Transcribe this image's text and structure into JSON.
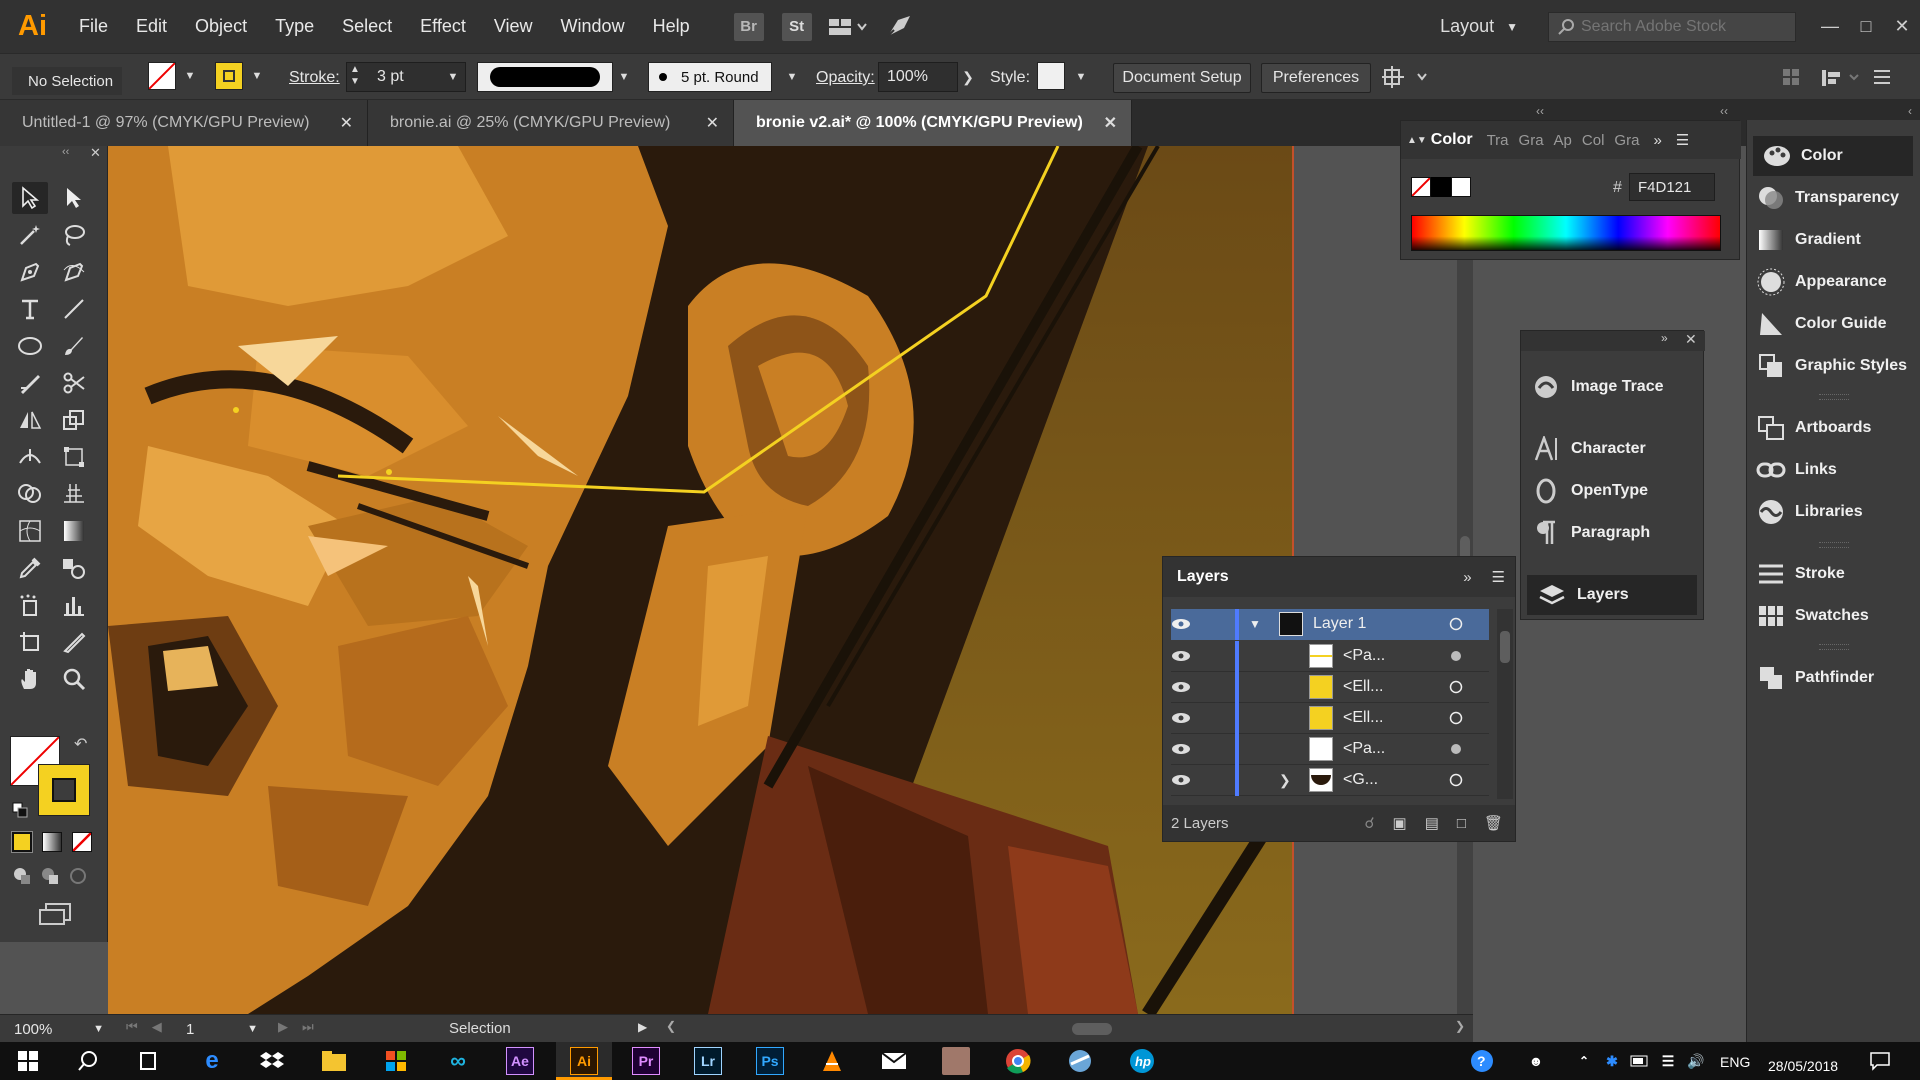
{
  "app": {
    "logo": "Ai"
  },
  "menu": [
    "File",
    "Edit",
    "Object",
    "Type",
    "Select",
    "Effect",
    "View",
    "Window",
    "Help"
  ],
  "bridge": {
    "br": "Br",
    "st": "St"
  },
  "workspace": "Layout",
  "stock_search": {
    "placeholder": "Search Adobe Stock"
  },
  "control": {
    "selection": "No Selection",
    "stroke_label": "Stroke:",
    "stroke_weight": "3 pt",
    "brush": "5 pt. Round",
    "opacity_label": "Opacity:",
    "opacity": "100%",
    "style_label": "Style:",
    "document_setup": "Document Setup",
    "preferences": "Preferences"
  },
  "tabs": [
    {
      "label": "Untitled-1 @ 97% (CMYK/GPU Preview)"
    },
    {
      "label": "bronie.ai @ 25% (CMYK/GPU Preview)"
    },
    {
      "label": "bronie v2.ai* @ 100% (CMYK/GPU Preview)"
    }
  ],
  "color_panel": {
    "title": "Color",
    "tabs": [
      "Tra",
      "Gra",
      "Ap",
      "Col",
      "Gra"
    ],
    "hex_label": "#",
    "hex": "F4D121"
  },
  "mid_panel": {
    "items": [
      "Image Trace",
      "Character",
      "OpenType",
      "Paragraph",
      "Layers"
    ]
  },
  "dock": {
    "items": [
      "Color",
      "Transparency",
      "Gradient",
      "Appearance",
      "Color Guide",
      "Graphic Styles",
      "Artboards",
      "Links",
      "Libraries",
      "Stroke",
      "Swatches",
      "Pathfinder"
    ]
  },
  "layers": {
    "title": "Layers",
    "rows": [
      "Layer 1",
      "<Pa...",
      "<Ell...",
      "<Ell...",
      "<Pa...",
      "<G..."
    ],
    "count": "2 Layers"
  },
  "status": {
    "zoom": "100%",
    "artboard": "1",
    "tool": "Selection"
  },
  "taskbar": {
    "lang": "ENG",
    "date": "28/05/2018",
    "apps": [
      "Ae",
      "Ai",
      "Pr",
      "Lr",
      "Ps"
    ]
  },
  "colors": {
    "fill": "#F4D121",
    "accent": "#ff9a00"
  }
}
